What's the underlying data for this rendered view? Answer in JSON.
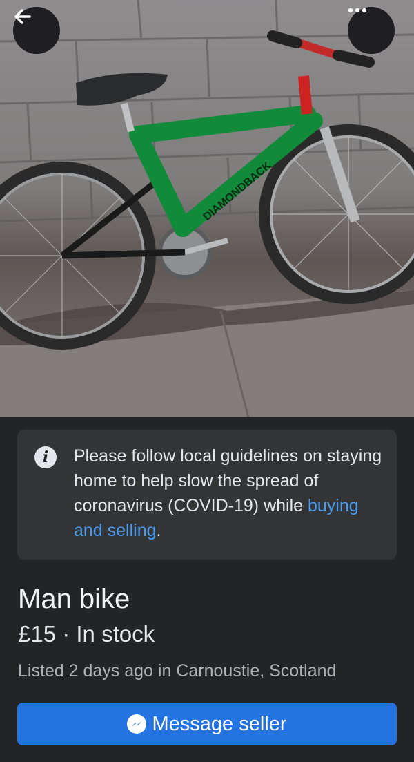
{
  "header": {
    "back_icon": "arrow-left-icon",
    "more_icon": "more-options-icon"
  },
  "photo": {
    "frame_text": "DIAMONDBACK"
  },
  "notice": {
    "icon": "info-icon",
    "text": "Please follow local guidelines on staying home to help slow the spread of coronavirus (COVID-19) while ",
    "link": "buying and selling",
    "suffix": "."
  },
  "listing": {
    "title": "Man bike",
    "price": "£15",
    "separator": " · ",
    "stock": "In stock",
    "listed": "Listed 2 days ago in Carnoustie, Scotland"
  },
  "actions": {
    "message_icon": "messenger-icon",
    "message_label": "Message seller",
    "accent_color": "#2374e1"
  }
}
